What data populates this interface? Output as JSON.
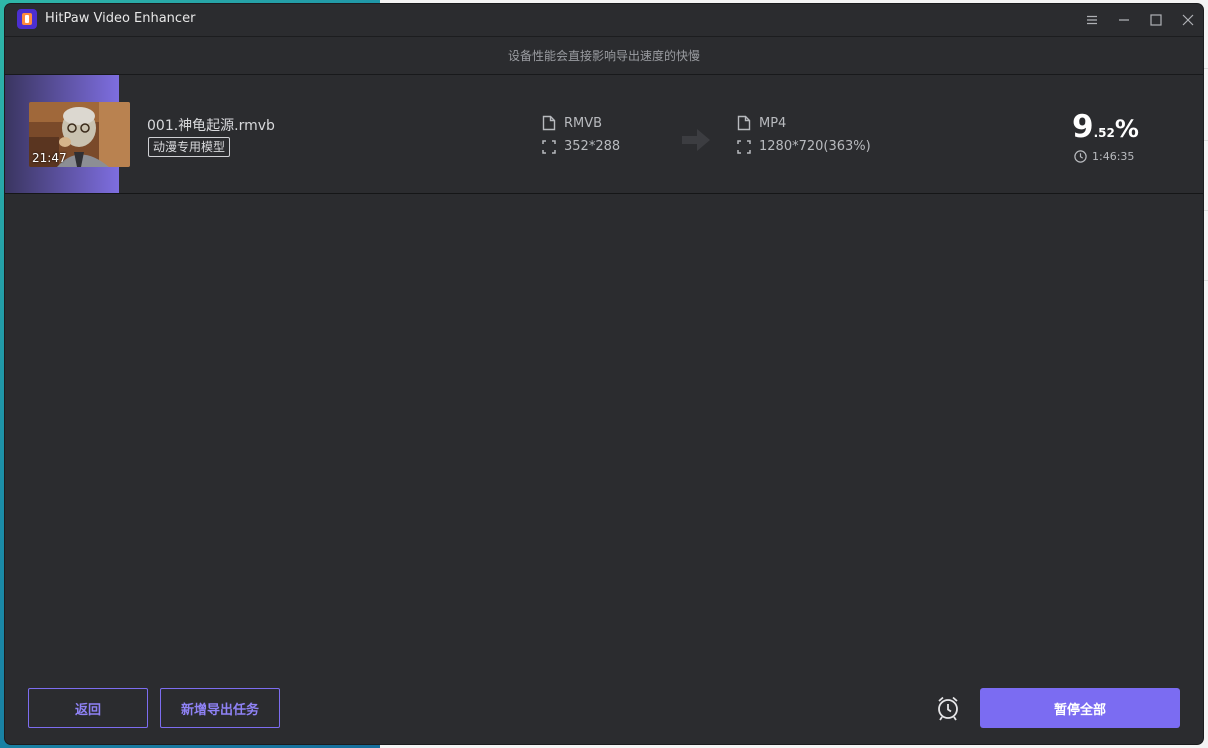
{
  "window": {
    "title": "HitPaw Video Enhancer"
  },
  "notice": "设备性能会直接影响导出速度的快慢",
  "task": {
    "file_name": "001.神龟起源.rmvb",
    "duration": "21:47",
    "model": "动漫专用模型",
    "source": {
      "format": "RMVB",
      "resolution": "352*288"
    },
    "target": {
      "format": "MP4",
      "resolution": "1280*720(363%)"
    },
    "progress": {
      "whole": "9",
      "decimal": ".52",
      "symbol": "%",
      "value_percent": 9.52
    },
    "time_remaining": "1:46:35"
  },
  "buttons": {
    "back": "返回",
    "add_export": "新增导出任务",
    "pause_all": "暂停全部"
  },
  "colors": {
    "accent": "#7b6cf2",
    "window_bg": "#2b2c2f",
    "text_muted": "#b8babe"
  },
  "icons": [
    "app-logo",
    "menu-icon",
    "minimize-icon",
    "maximize-icon",
    "close-icon",
    "file-icon",
    "resolution-icon",
    "arrow-right-icon",
    "clock-icon",
    "alarm-icon"
  ]
}
